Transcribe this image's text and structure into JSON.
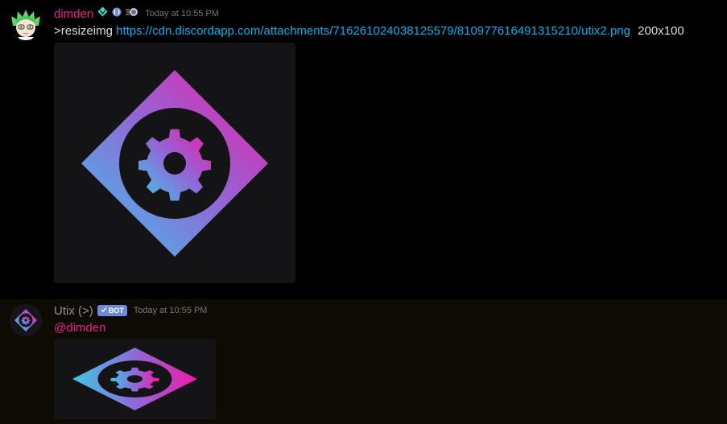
{
  "messages": [
    {
      "author": "dimden",
      "author_color": "#e91e8c",
      "badges": [
        "hypesquad-balance-icon",
        "early-supporter-icon",
        "nitro-boost-icon"
      ],
      "timestamp": "Today at 10:55 PM",
      "command": ">resizeimg",
      "link": "https://cdn.discordapp.com/attachments/716261024038125579/810977616491315210/utix2.png",
      "argument": "200x100",
      "attachment_icon": "utix-gear-logo"
    },
    {
      "author": "Utix (>)",
      "author_color": "#8e9297",
      "bot_tag": "BOT",
      "timestamp": "Today at 10:55 PM",
      "mention": "@dimden",
      "attachment_icon": "utix-gear-logo-resized"
    }
  ],
  "colors": {
    "brand_pink": "#e91e8c",
    "brand_cyan": "#4fc3e0",
    "link": "#00b0f4",
    "bot_tag": "#7289da"
  }
}
